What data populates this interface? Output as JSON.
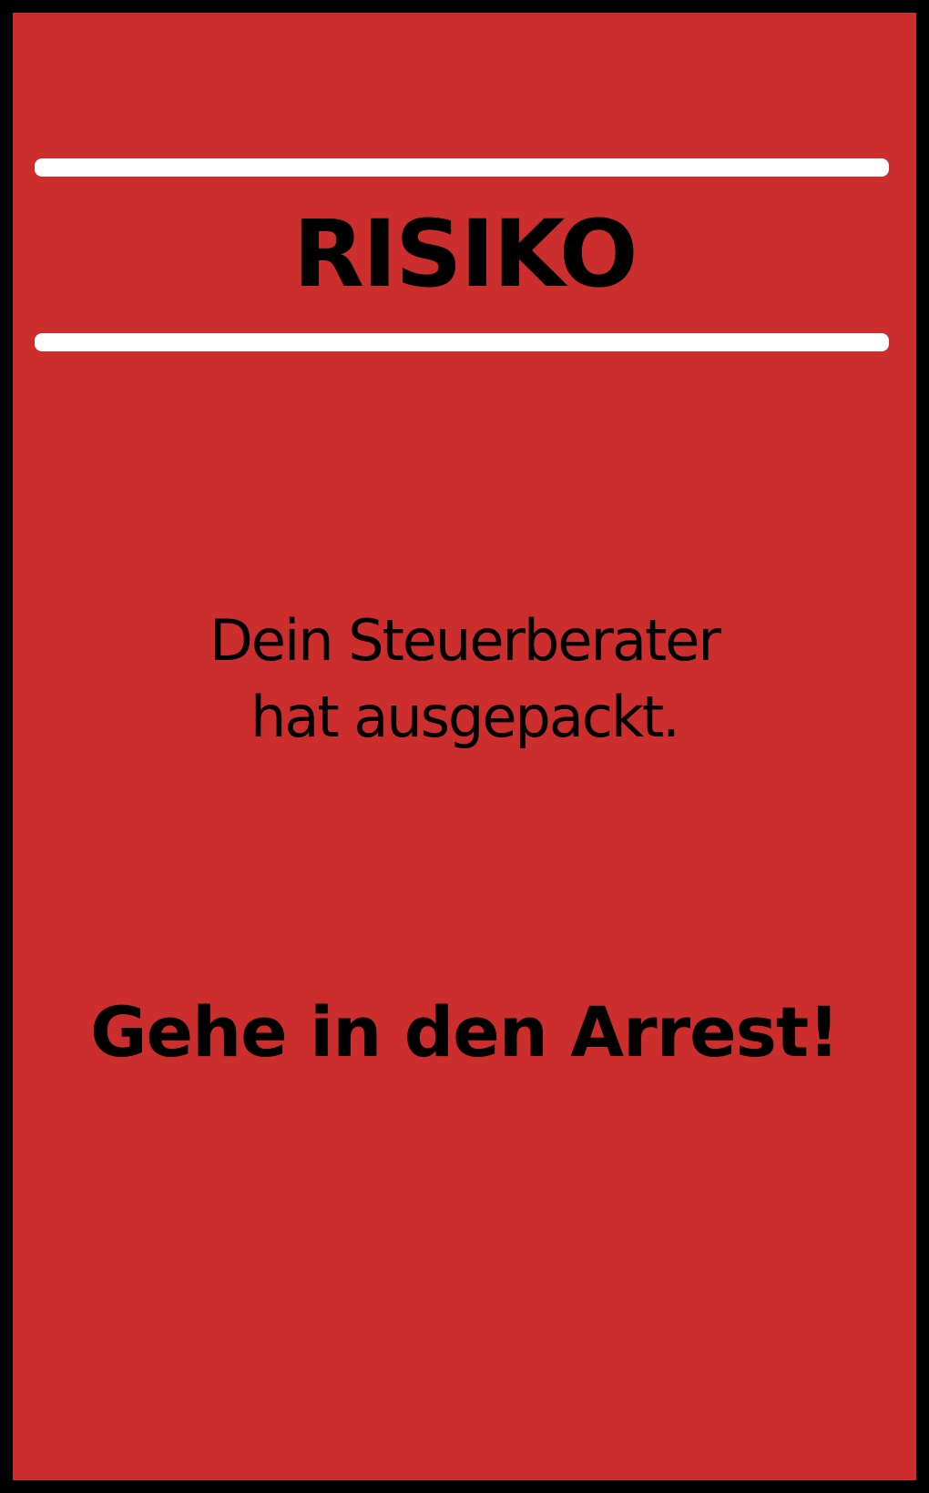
{
  "card": {
    "title": "RISIKO",
    "message_lines": [
      "Dein Steuerberater",
      "hat ausgepackt."
    ],
    "action": "Gehe in den Arrest!",
    "colors": {
      "background": "#cc2d2d",
      "border": "#000000",
      "rule": "#ffffff",
      "text": "#000000"
    }
  }
}
